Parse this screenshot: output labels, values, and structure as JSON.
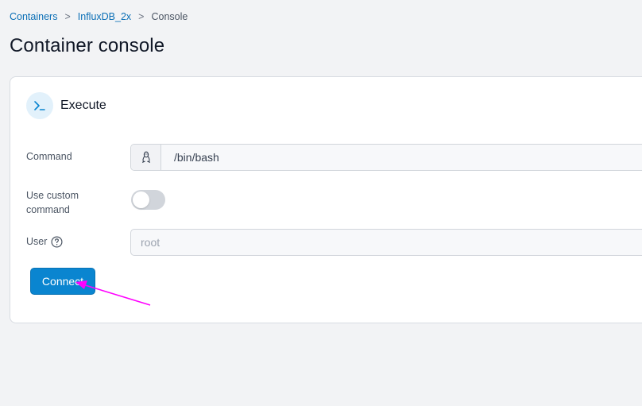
{
  "breadcrumb": {
    "items": [
      "Containers",
      "InfluxDB_2x"
    ],
    "separator": ">",
    "current": "Console"
  },
  "page": {
    "title": "Container console"
  },
  "panel": {
    "title": "Execute",
    "icon": "terminal-icon",
    "command": {
      "label": "Command",
      "addon_icon": "linux-icon",
      "value": "/bin/bash"
    },
    "custom_command": {
      "label_line1": "Use custom",
      "label_line2": "command",
      "state": "off"
    },
    "user": {
      "label": "User",
      "help_icon": "question-circle-icon",
      "placeholder": "root"
    },
    "connect_label": "Connect"
  },
  "colors": {
    "accent": "#0a85d0",
    "link": "#0b6fb6",
    "annotation": "#ff00ff"
  }
}
